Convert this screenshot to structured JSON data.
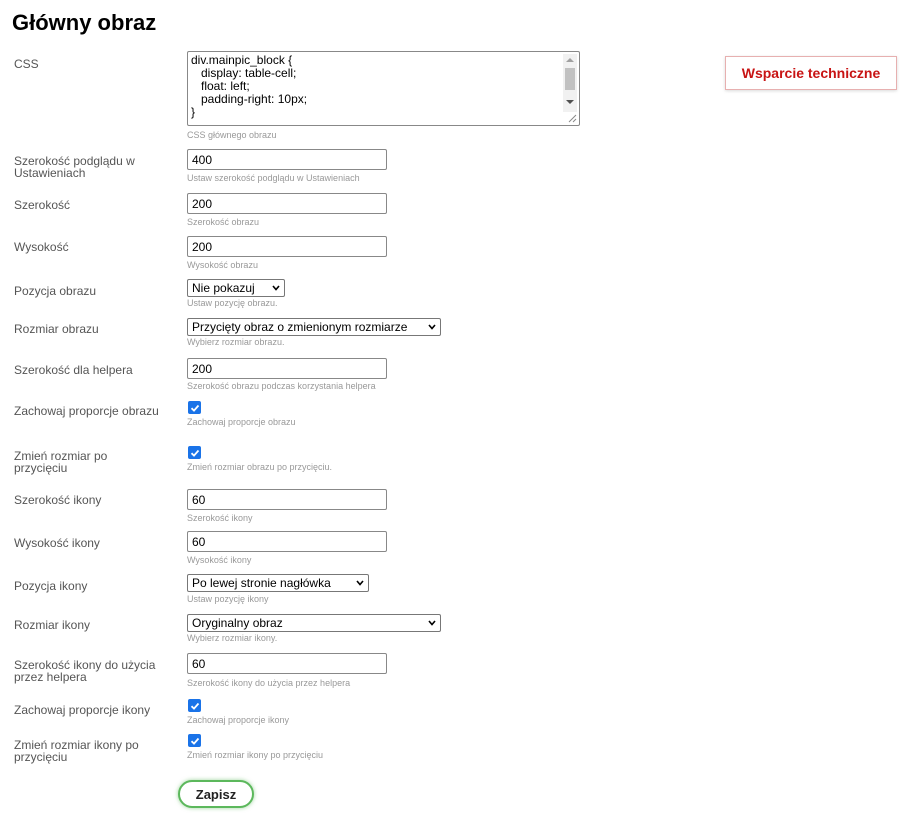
{
  "page": {
    "title": "Główny obraz",
    "support_button": "Wsparcie techniczne"
  },
  "fields": {
    "css": {
      "label": "CSS",
      "value": "div.mainpic_block {\n   display: table-cell;\n   float: left;\n   padding-right: 10px;\n}",
      "hint": "CSS głównego obrazu"
    },
    "preview_width": {
      "label": "Szerokość podglądu w Ustawieniach",
      "value": "400",
      "hint": "Ustaw szerokość podglądu w Ustawieniach"
    },
    "width": {
      "label": "Szerokość",
      "value": "200",
      "hint": "Szerokość obrazu"
    },
    "height": {
      "label": "Wysokość",
      "value": "200",
      "hint": "Wysokość obrazu"
    },
    "image_position": {
      "label": "Pozycja obrazu",
      "value": "Nie pokazuj",
      "hint": "Ustaw pozycję obrazu."
    },
    "image_size": {
      "label": "Rozmiar obrazu",
      "value": "Przycięty obraz o zmienionym rozmiarze",
      "hint": "Wybierz rozmiar obrazu."
    },
    "helper_width": {
      "label": "Szerokość dla helpera",
      "value": "200",
      "hint": "Szerokość obrazu podczas korzystania helpera"
    },
    "keep_ratio": {
      "label": "Zachowaj proporcje obrazu",
      "checked": true,
      "hint": "Zachowaj proporcje obrazu"
    },
    "resize_after_crop": {
      "label": "Zmień rozmiar po przycięciu",
      "checked": true,
      "hint": "Zmień rozmiar obrazu po przycięciu."
    },
    "icon_width": {
      "label": "Szerokość ikony",
      "value": "60",
      "hint": "Szerokość ikony"
    },
    "icon_height": {
      "label": "Wysokość ikony",
      "value": "60",
      "hint": "Wysokość ikony"
    },
    "icon_position": {
      "label": "Pozycja ikony",
      "value": "Po lewej stronie nagłówka",
      "hint": "Ustaw pozycję ikony"
    },
    "icon_size": {
      "label": "Rozmiar ikony",
      "value": "Oryginalny obraz",
      "hint": "Wybierz rozmiar ikony."
    },
    "icon_helper_width": {
      "label": "Szerokość ikony do użycia przez helpera",
      "value": "60",
      "hint": "Szerokość ikony do użycia przez helpera"
    },
    "icon_keep_ratio": {
      "label": "Zachowaj proporcje ikony",
      "checked": true,
      "hint": "Zachowaj proporcje ikony"
    },
    "icon_resize_after_crop": {
      "label": "Zmień rozmiar ikony po przycięciu",
      "checked": true,
      "hint": "Zmień rozmiar ikony po przycięciu"
    }
  },
  "actions": {
    "save": "Zapisz"
  },
  "colors": {
    "accent_checkbox": "#1a73e8",
    "support_text": "#c81414",
    "save_border": "#5cb85c"
  }
}
